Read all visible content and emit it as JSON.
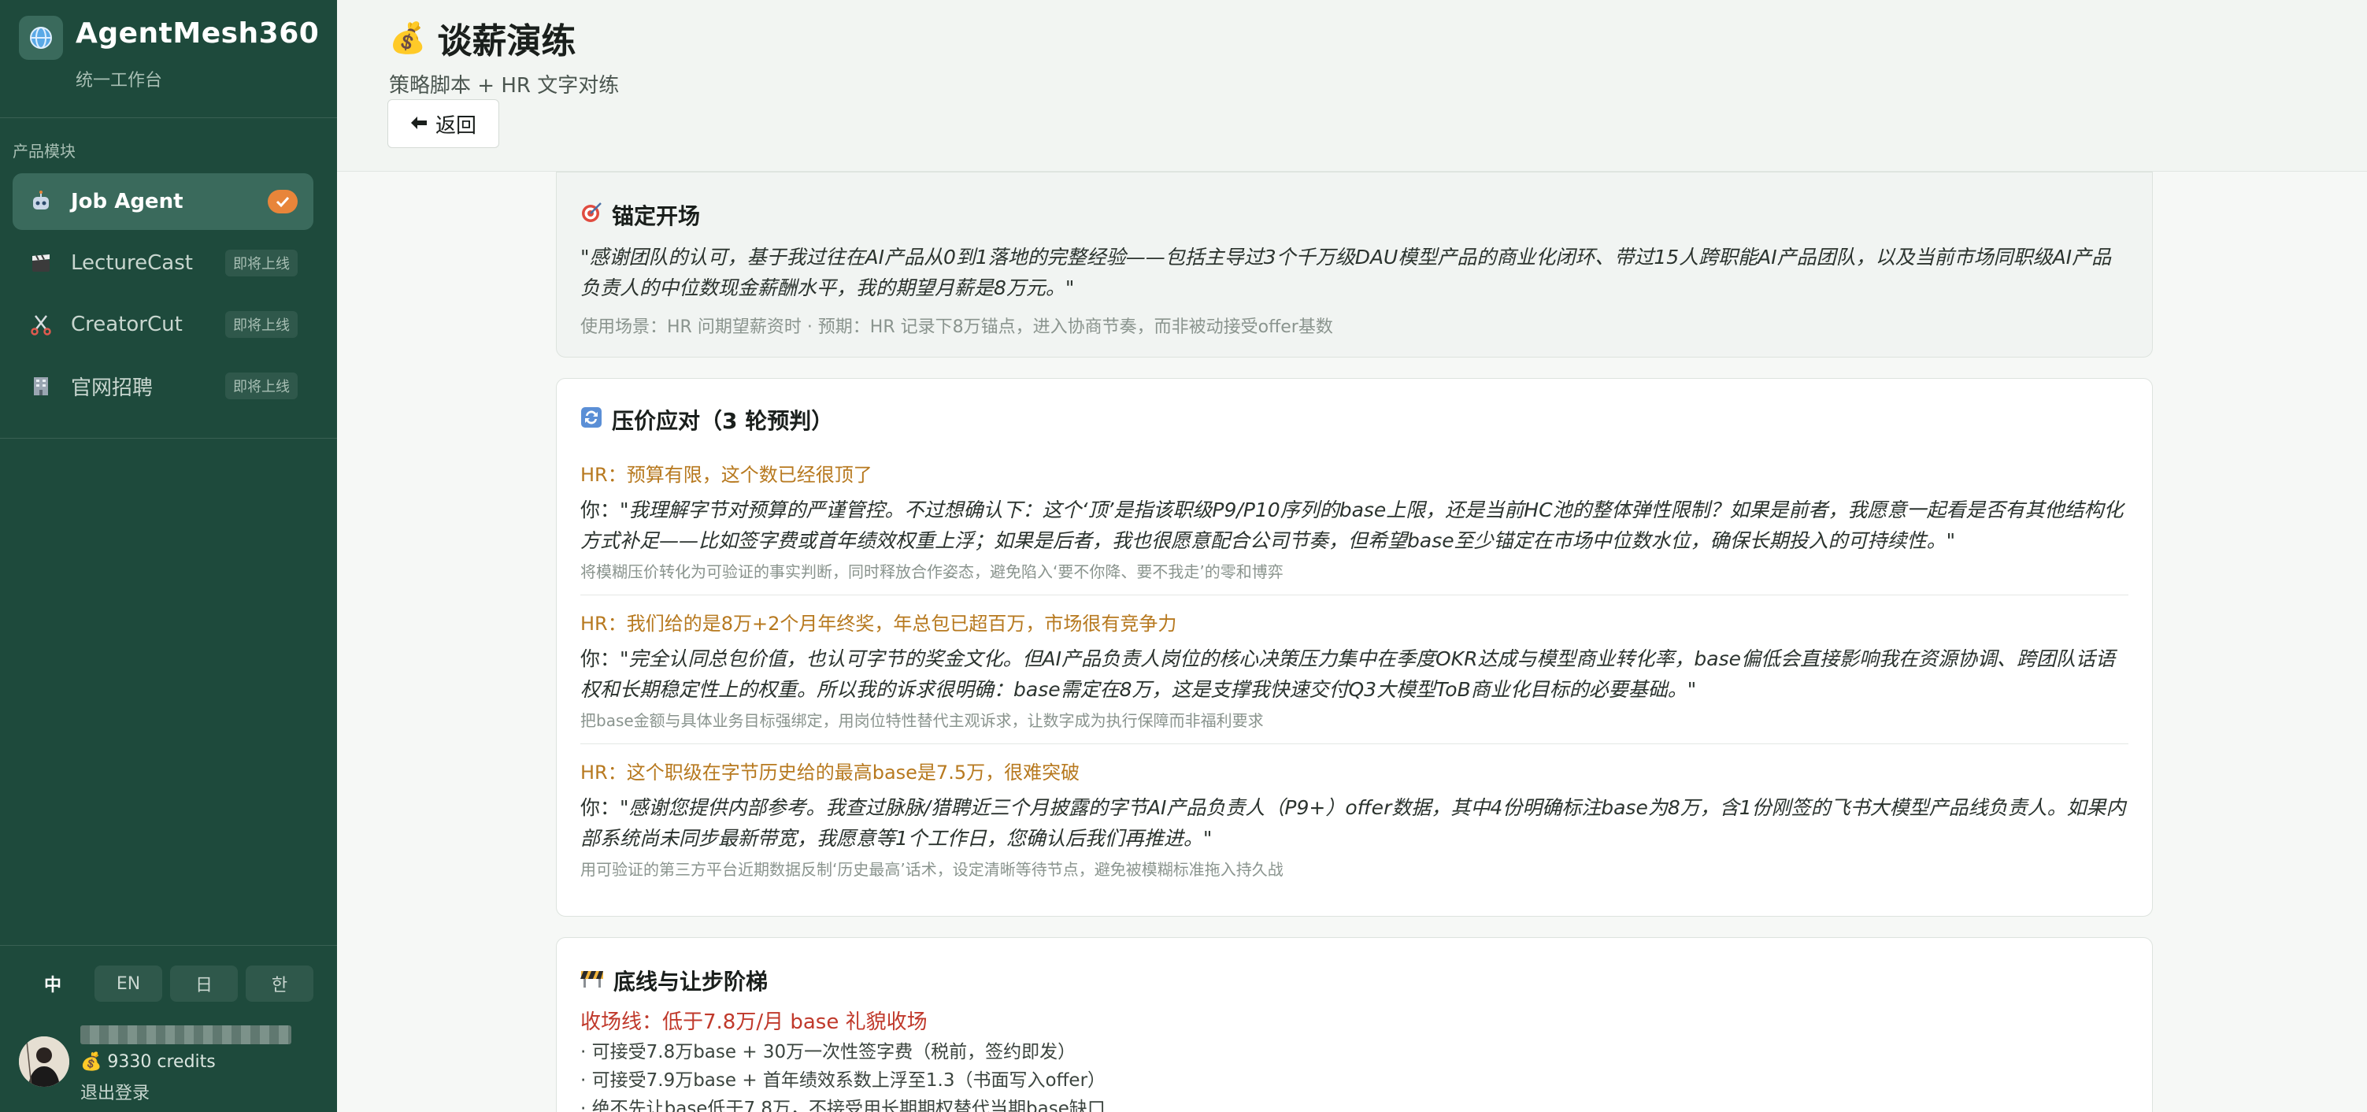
{
  "sidebar": {
    "brand_title": "AgentMesh360",
    "brand_subtitle": "统一工作台",
    "section_label": "产品模块",
    "items": [
      {
        "label": "Job Agent",
        "badge": "",
        "active": true
      },
      {
        "label": "LectureCast",
        "badge": "即将上线",
        "active": false
      },
      {
        "label": "CreatorCut",
        "badge": "即将上线",
        "active": false
      },
      {
        "label": "官网招聘",
        "badge": "即将上线",
        "active": false
      }
    ],
    "languages": [
      "中",
      "EN",
      "日",
      "한"
    ],
    "selected_language": "中",
    "credits": "9330 credits",
    "logout": "退出登录"
  },
  "header": {
    "title": "谈薪演练",
    "subtitle": "策略脚本 + HR 文字对练",
    "back_label": "返回"
  },
  "anchor_card": {
    "title": "锚定开场",
    "quote": "\"感谢团队的认可，基于我过往在AI产品从0到1落地的完整经验——包括主导过3个千万级DAU模型产品的商业化闭环、带过15人跨职能AI产品团队，以及当前市场同职级AI产品负责人的中位数现金薪酬水平，我的期望月薪是8万元。\"",
    "meta": "使用场景：HR 问期望薪资时 · 预期：HR 记录下8万锚点，进入协商节奏，而非被动接受offer基数"
  },
  "rounds_card": {
    "title": "压价应对（3 轮预判）",
    "rounds": [
      {
        "hr": "HR：预算有限，这个数已经很顶了",
        "you_prefix": "你：",
        "you": "\"我理解字节对预算的严谨管控。不过想确认下：这个‘顶’是指该职级P9/P10序列的base上限，还是当前HC池的整体弹性限制？如果是前者，我愿意一起看是否有其他结构化方式补足——比如签字费或首年绩效权重上浮；如果是后者，我也很愿意配合公司节奏，但希望base至少锚定在市场中位数水位，确保长期投入的可持续性。\"",
        "tip": "将模糊压价转化为可验证的事实判断，同时释放合作姿态，避免陷入‘要不你降、要不我走’的零和博弈"
      },
      {
        "hr": "HR：我们给的是8万+2个月年终奖，年总包已超百万，市场很有竞争力",
        "you_prefix": "你：",
        "you": "\"完全认同总包价值，也认可字节的奖金文化。但AI产品负责人岗位的核心决策压力集中在季度OKR达成与模型商业转化率，base偏低会直接影响我在资源协调、跨团队话语权和长期稳定性上的权重。所以我的诉求很明确：base需定在8万，这是支撑我快速交付Q3大模型ToB商业化目标的必要基础。\"",
        "tip": "把base金额与具体业务目标强绑定，用岗位特性替代主观诉求，让数字成为执行保障而非福利要求"
      },
      {
        "hr": "HR：这个职级在字节历史给的最高base是7.5万，很难突破",
        "you_prefix": "你：",
        "you": "\"感谢您提供内部参考。我查过脉脉/猎聘近三个月披露的字节AI产品负责人（P9+）offer数据，其中4份明确标注base为8万，含1份刚签的飞书大模型产品线负责人。如果内部系统尚未同步最新带宽，我愿意等1个工作日，您确认后我们再推进。\"",
        "tip": "用可验证的第三方平台近期数据反制‘历史最高’话术，设定清晰等待节点，避免被模糊标准拖入持久战"
      }
    ]
  },
  "floor_card": {
    "title": "底线与让步阶梯",
    "floor_line": "收场线：低于7.8万/月 base 礼貌收场",
    "steps": [
      "· 可接受7.8万base + 30万一次性签字费（税前，签约即发）",
      "· 可接受7.9万base + 首年绩效系数上浮至1.3（书面写入offer）",
      "· 绝不先让base低于7.8万，不接受用长期期权替代当期base缺口"
    ]
  },
  "colors": {
    "sidebar_bg": "#1e4a3c",
    "active_item_bg": "#3a6a5c",
    "accent_orange": "#e8853a",
    "hr_text": "#b7791f",
    "floor_red": "#c0392b"
  }
}
